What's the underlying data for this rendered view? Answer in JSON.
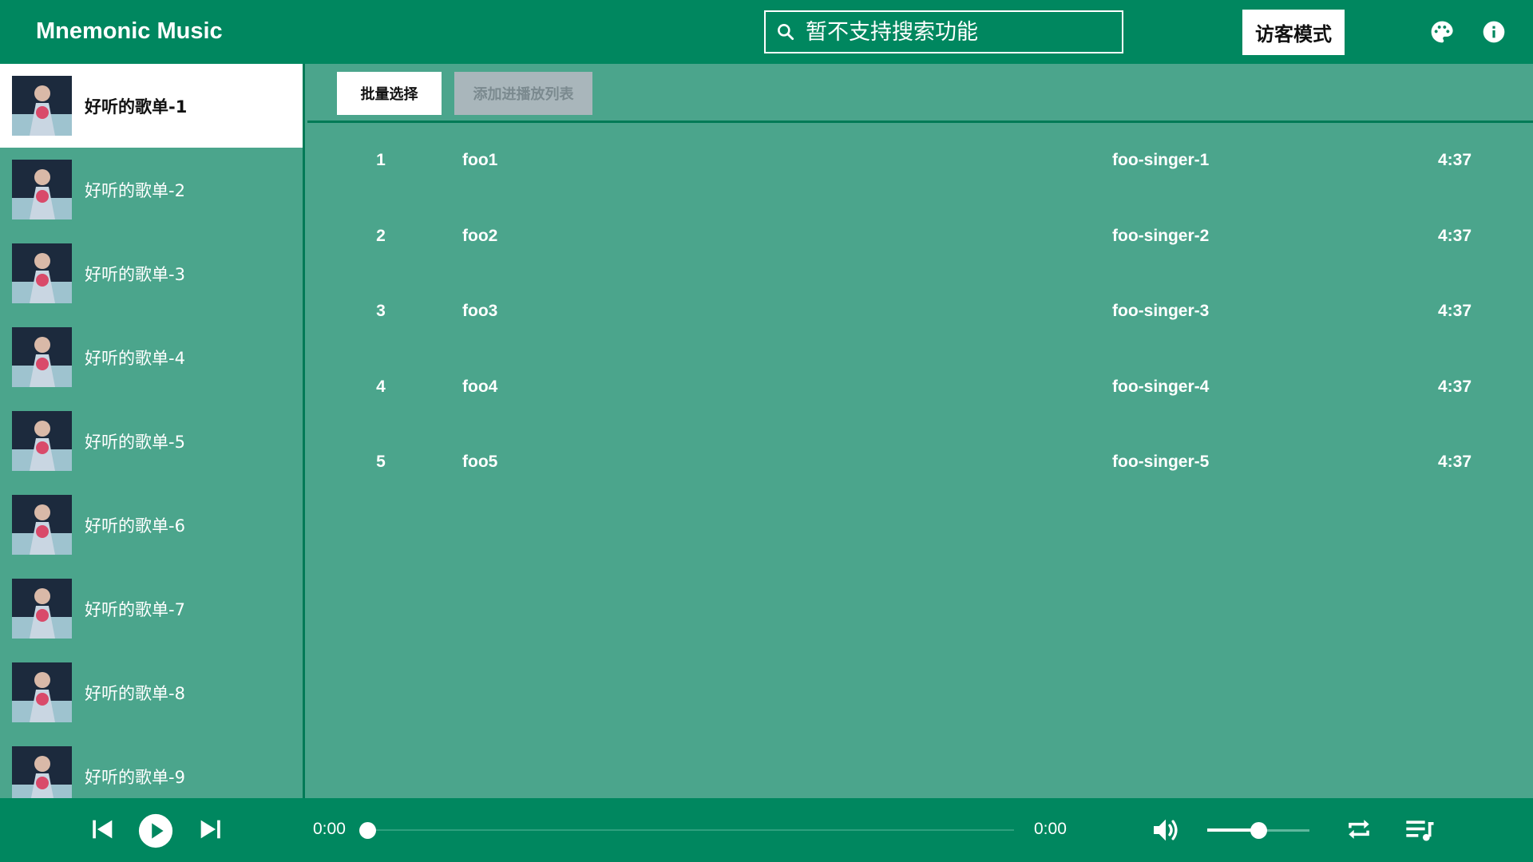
{
  "header": {
    "title": "Mnemonic Music",
    "search_placeholder": "暂不支持搜索功能",
    "guest_mode_label": "访客模式"
  },
  "sidebar": {
    "items": [
      {
        "label": "好听的歌单-1",
        "active": true
      },
      {
        "label": "好听的歌单-2"
      },
      {
        "label": "好听的歌单-3"
      },
      {
        "label": "好听的歌单-4"
      },
      {
        "label": "好听的歌单-5"
      },
      {
        "label": "好听的歌单-6"
      },
      {
        "label": "好听的歌单-7"
      },
      {
        "label": "好听的歌单-8"
      },
      {
        "label": "好听的歌单-9"
      }
    ]
  },
  "toolbar": {
    "batch_select_label": "批量选择",
    "add_to_playlist_label": "添加进播放列表"
  },
  "songs": [
    {
      "index": "1",
      "name": "foo1",
      "singer": "foo-singer-1",
      "duration": "4:37"
    },
    {
      "index": "2",
      "name": "foo2",
      "singer": "foo-singer-2",
      "duration": "4:37"
    },
    {
      "index": "3",
      "name": "foo3",
      "singer": "foo-singer-3",
      "duration": "4:37"
    },
    {
      "index": "4",
      "name": "foo4",
      "singer": "foo-singer-4",
      "duration": "4:37"
    },
    {
      "index": "5",
      "name": "foo5",
      "singer": "foo-singer-5",
      "duration": "4:37"
    }
  ],
  "player": {
    "current_time": "0:00",
    "total_time": "0:00",
    "progress": 0,
    "volume": 0.5
  },
  "colors": {
    "header_bg": "#00875f",
    "content_bg": "#4ba58c",
    "active_item_bg": "#ffffff",
    "disabled_button_bg": "#a9b6bb"
  },
  "icons": [
    "search-icon",
    "palette-icon",
    "info-icon",
    "skip-previous-icon",
    "play-icon",
    "skip-next-icon",
    "volume-icon",
    "repeat-icon",
    "playlist-icon"
  ]
}
